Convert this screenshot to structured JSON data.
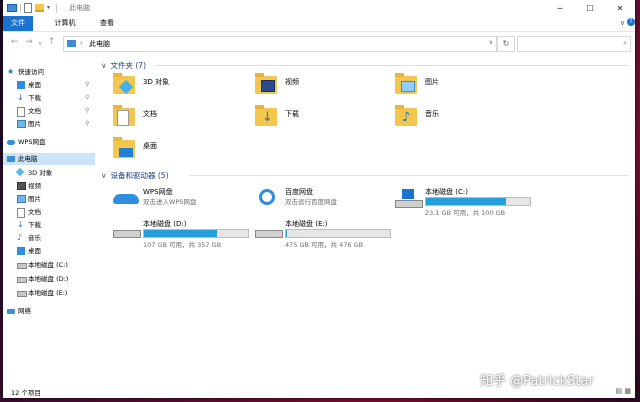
{
  "window_title": "此电脑",
  "window_controls": {
    "minimize": "─",
    "maximize": "☐",
    "close": "✕"
  },
  "ribbon": {
    "file": "文件",
    "computer": "计算机",
    "view": "查看",
    "expand": "∨",
    "help": "?"
  },
  "address": {
    "crumb": "此电脑",
    "search_placeholder": ""
  },
  "nav": [
    {
      "label": "快速访问",
      "icon": "star-icon",
      "type": "star"
    },
    {
      "label": "桌面",
      "icon": "desktop-icon",
      "type": "desk",
      "pin": true
    },
    {
      "label": "下载",
      "icon": "download-icon",
      "type": "dl",
      "pin": true
    },
    {
      "label": "文档",
      "icon": "document-icon",
      "type": "doc",
      "pin": true
    },
    {
      "label": "图片",
      "icon": "picture-icon",
      "type": "pic",
      "pin": true
    },
    {
      "label": "WPS网盘",
      "icon": "cloud-icon",
      "type": "cloud"
    },
    {
      "label": "此电脑",
      "icon": "computer-icon",
      "type": "pc",
      "selected": true
    },
    {
      "label": "3D 对象",
      "icon": "3d-objects-icon",
      "type": "obj"
    },
    {
      "label": "视频",
      "icon": "video-icon",
      "type": "vid"
    },
    {
      "label": "图片",
      "icon": "picture-icon",
      "type": "pic"
    },
    {
      "label": "文档",
      "icon": "document-icon",
      "type": "doc"
    },
    {
      "label": "下载",
      "icon": "download-icon",
      "type": "dl"
    },
    {
      "label": "音乐",
      "icon": "music-icon",
      "type": "mus"
    },
    {
      "label": "桌面",
      "icon": "desktop-icon",
      "type": "desk"
    },
    {
      "label": "本地磁盘 (C:)",
      "icon": "drive-icon",
      "type": "drv"
    },
    {
      "label": "本地磁盘 (D:)",
      "icon": "drive-icon",
      "type": "drv"
    },
    {
      "label": "本地磁盘 (E:)",
      "icon": "drive-icon",
      "type": "drv"
    },
    {
      "label": "网络",
      "icon": "network-icon",
      "type": "net"
    }
  ],
  "folders_header": "文件夹 (7)",
  "folders": [
    {
      "label": "3D 对象",
      "ov": "obj"
    },
    {
      "label": "视频",
      "ov": "vid"
    },
    {
      "label": "图片",
      "ov": "pic"
    },
    {
      "label": "文档",
      "ov": "doc"
    },
    {
      "label": "下载",
      "ov": "dl"
    },
    {
      "label": "音乐",
      "ov": "mus"
    },
    {
      "label": "桌面",
      "ov": "desk"
    }
  ],
  "devices_header": "设备和驱动器 (5)",
  "devices": [
    {
      "name": "WPS网盘",
      "sub": "双击进入WPS网盘",
      "icon": "wps"
    },
    {
      "name": "百度网盘",
      "sub": "双击运行百度网盘",
      "icon": "bd"
    },
    {
      "name": "本地磁盘 (C:)",
      "size": "23.1 GB 可用，共 100 GB",
      "used": 0.77,
      "icon": "sys"
    },
    {
      "name": "本地磁盘 (D:)",
      "size": "107 GB 可用，共 357 GB",
      "used": 0.7,
      "icon": "hdd"
    },
    {
      "name": "本地磁盘 (E:)",
      "size": "475 GB 可用，共 476 GB",
      "used": 0.01,
      "icon": "hdd"
    }
  ],
  "status": "12 个项目",
  "watermark": "知乎 @PatrickStar"
}
